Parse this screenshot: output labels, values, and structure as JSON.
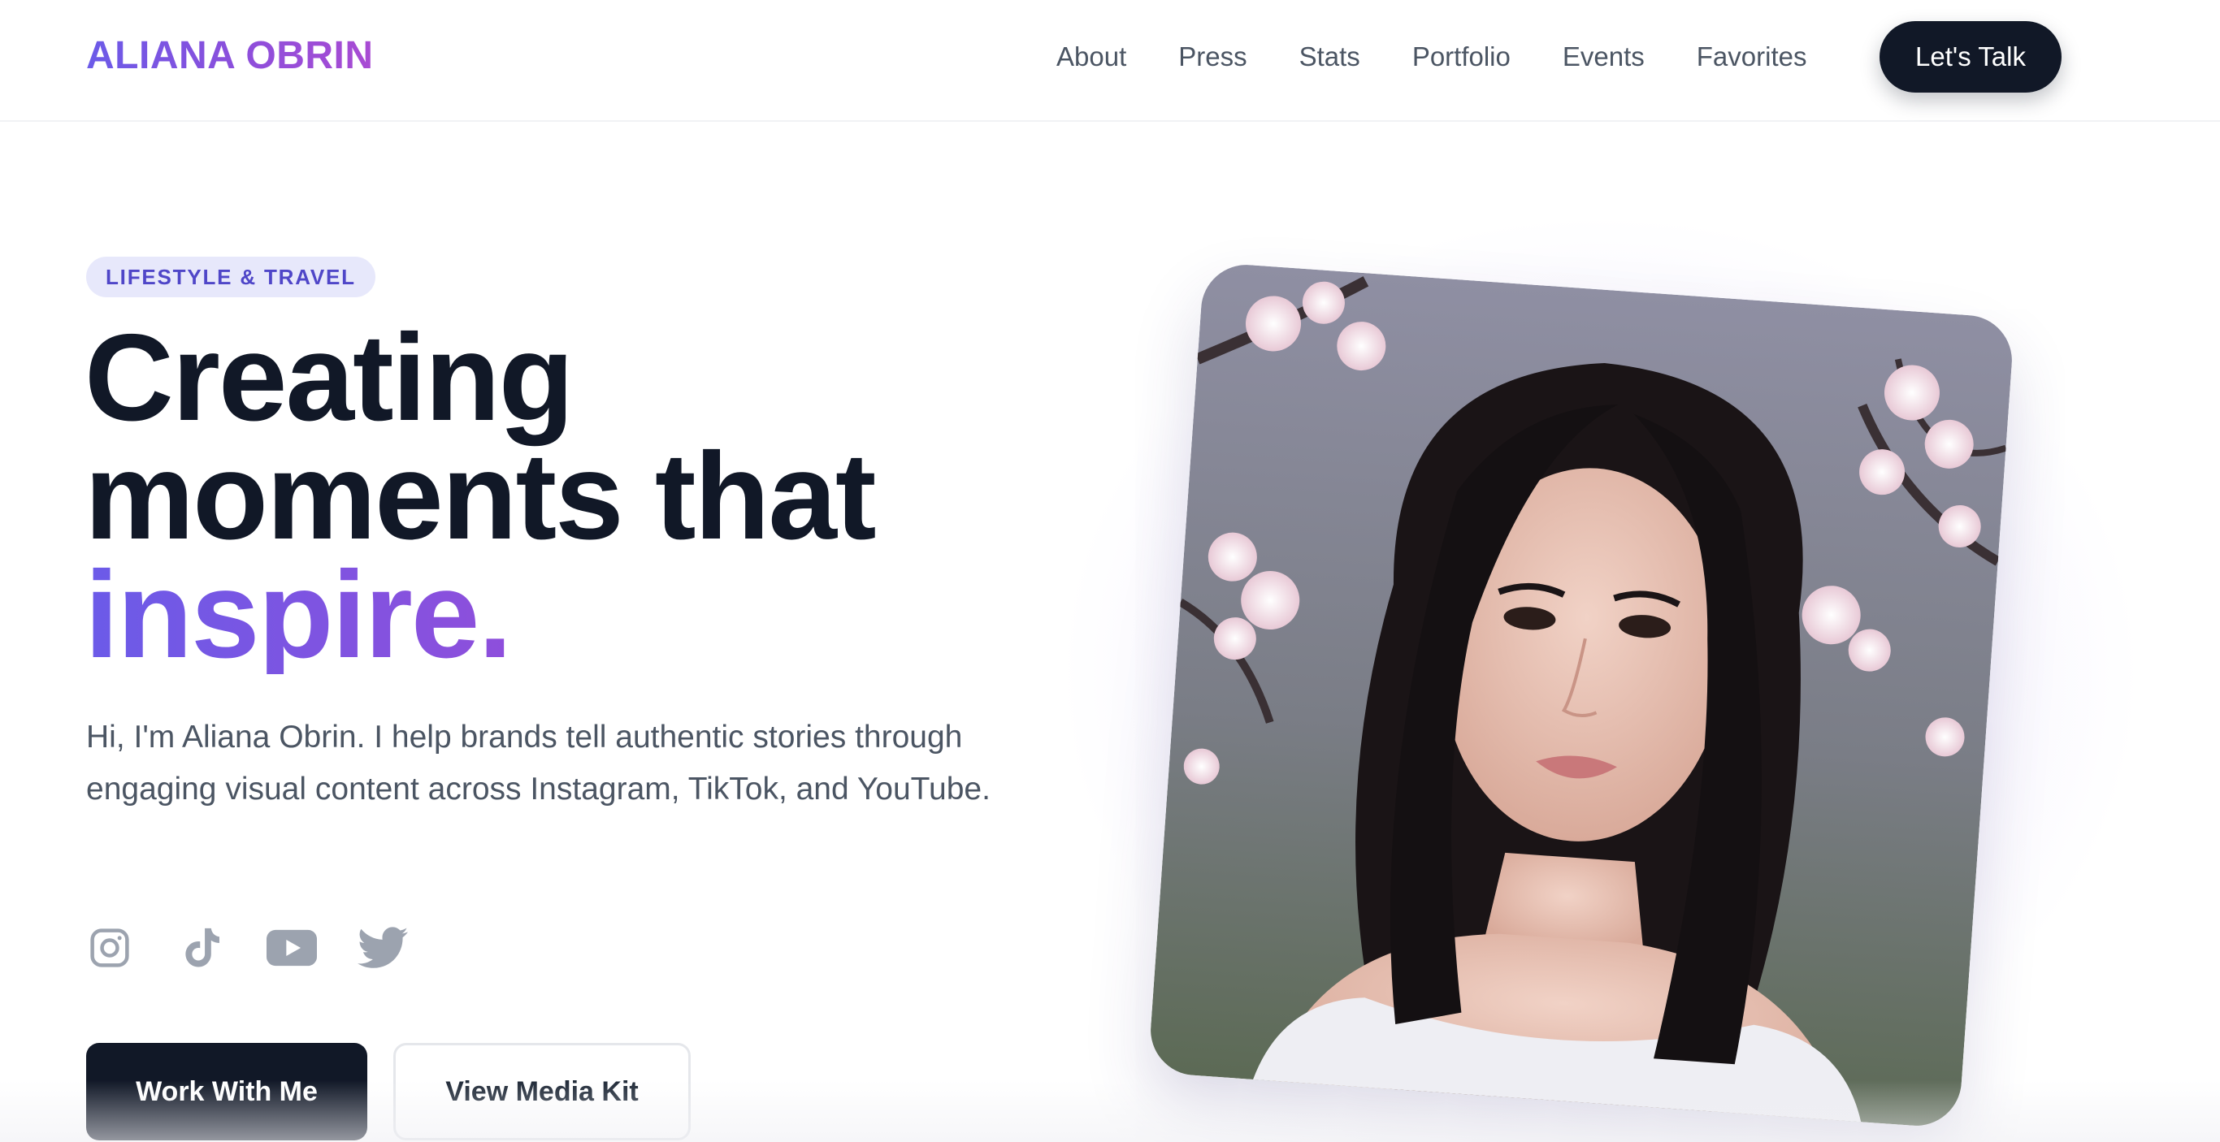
{
  "brand": {
    "logo_text": "ALIANA OBRIN"
  },
  "nav": {
    "links": [
      "About",
      "Press",
      "Stats",
      "Portfolio",
      "Events",
      "Favorites"
    ],
    "cta_label": "Let's Talk"
  },
  "hero": {
    "badge": "LIFESTYLE & TRAVEL",
    "headline": {
      "line1": "Creating",
      "line2": "moments that",
      "highlight": "inspire."
    },
    "intro": "Hi, I'm Aliana Obrin. I help brands tell authentic stories through engaging visual content across Instagram, TikTok, and YouTube.",
    "socials": [
      "instagram-icon",
      "tiktok-icon",
      "youtube-icon",
      "twitter-icon"
    ],
    "primary_button": "Work With Me",
    "secondary_button": "View Media Kit"
  },
  "colors": {
    "brand_gradient_start": "#6b5be8",
    "brand_gradient_end": "#b04ad2",
    "dark": "#111827",
    "badge_bg": "#e7e8fb",
    "badge_text": "#4f46c8",
    "icon_gray": "#9ca3af"
  }
}
